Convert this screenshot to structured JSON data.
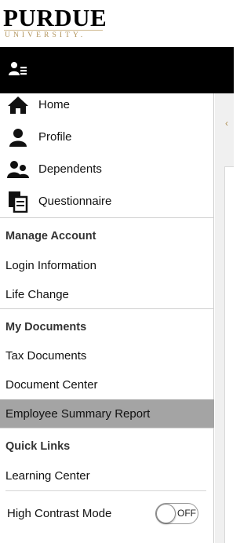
{
  "brand": {
    "name": "PURDUE",
    "subtitle": "UNIVERSITY.",
    "accent_color": "#CFB991"
  },
  "topbar": {
    "icon": "user-list-icon"
  },
  "nav": {
    "items": [
      {
        "label": "Home",
        "icon": "home-icon"
      },
      {
        "label": "Profile",
        "icon": "profile-icon"
      },
      {
        "label": "Dependents",
        "icon": "dependents-icon"
      },
      {
        "label": "Questionnaire",
        "icon": "questionnaire-icon"
      }
    ]
  },
  "manage_account": {
    "header": "Manage Account",
    "links": [
      "Login Information",
      "Life Change"
    ]
  },
  "my_documents": {
    "header": "My Documents",
    "links": [
      "Tax Documents",
      "Document Center",
      "Employee Summary Report"
    ],
    "active_index": 2
  },
  "quick_links": {
    "header": "Quick Links",
    "links": [
      "Learning Center"
    ]
  },
  "high_contrast": {
    "label": "High Contrast Mode",
    "toggle_text": "OFF",
    "enabled": false
  }
}
